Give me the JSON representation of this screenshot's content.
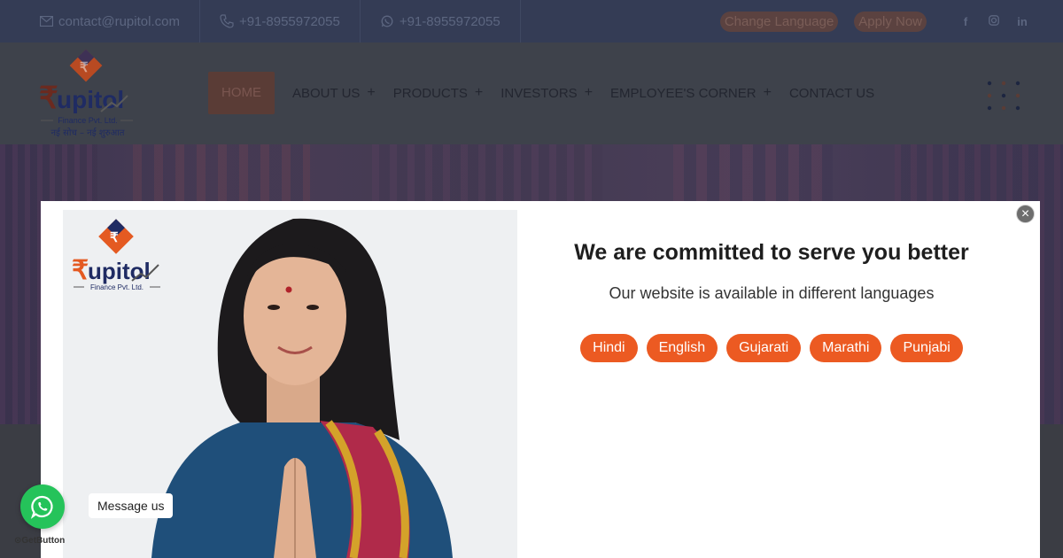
{
  "topbar": {
    "email": "contact@rupitol.com",
    "phone": "+91-8955972055",
    "whatsapp": "+91-8955972055",
    "change_language": "Change Language",
    "apply_now": "Apply Now",
    "social": [
      "facebook-icon",
      "instagram-icon",
      "linkedin-icon"
    ]
  },
  "logo": {
    "name": "upitol",
    "tagline": "Finance Pvt. Ltd.",
    "slogan": "नई सोच – नई शुरुआत"
  },
  "nav": {
    "items": [
      {
        "label": "HOME",
        "has_submenu": false,
        "active": true
      },
      {
        "label": "ABOUT US",
        "has_submenu": true
      },
      {
        "label": "PRODUCTS",
        "has_submenu": true
      },
      {
        "label": "INVESTORS",
        "has_submenu": true
      },
      {
        "label": "EMPLOYEE'S CORNER",
        "has_submenu": true
      },
      {
        "label": "CONTACT US",
        "has_submenu": false
      }
    ],
    "submenu_symbol": "+"
  },
  "modal": {
    "title": "We are committed to serve you better",
    "subtitle": "Our website is available in different languages",
    "languages": [
      "Hindi",
      "English",
      "Gujarati",
      "Marathi",
      "Punjabi"
    ],
    "close_symbol": "×",
    "photo_logo_name": "upitol",
    "photo_logo_tagline": "Finance Pvt. Ltd."
  },
  "whatsapp_widget": {
    "message": "Message us",
    "branding": "GetButton"
  },
  "colors": {
    "accent": "#ec5a22",
    "topbar_bg": "#343c55",
    "whatsapp_green": "#25c35a"
  }
}
